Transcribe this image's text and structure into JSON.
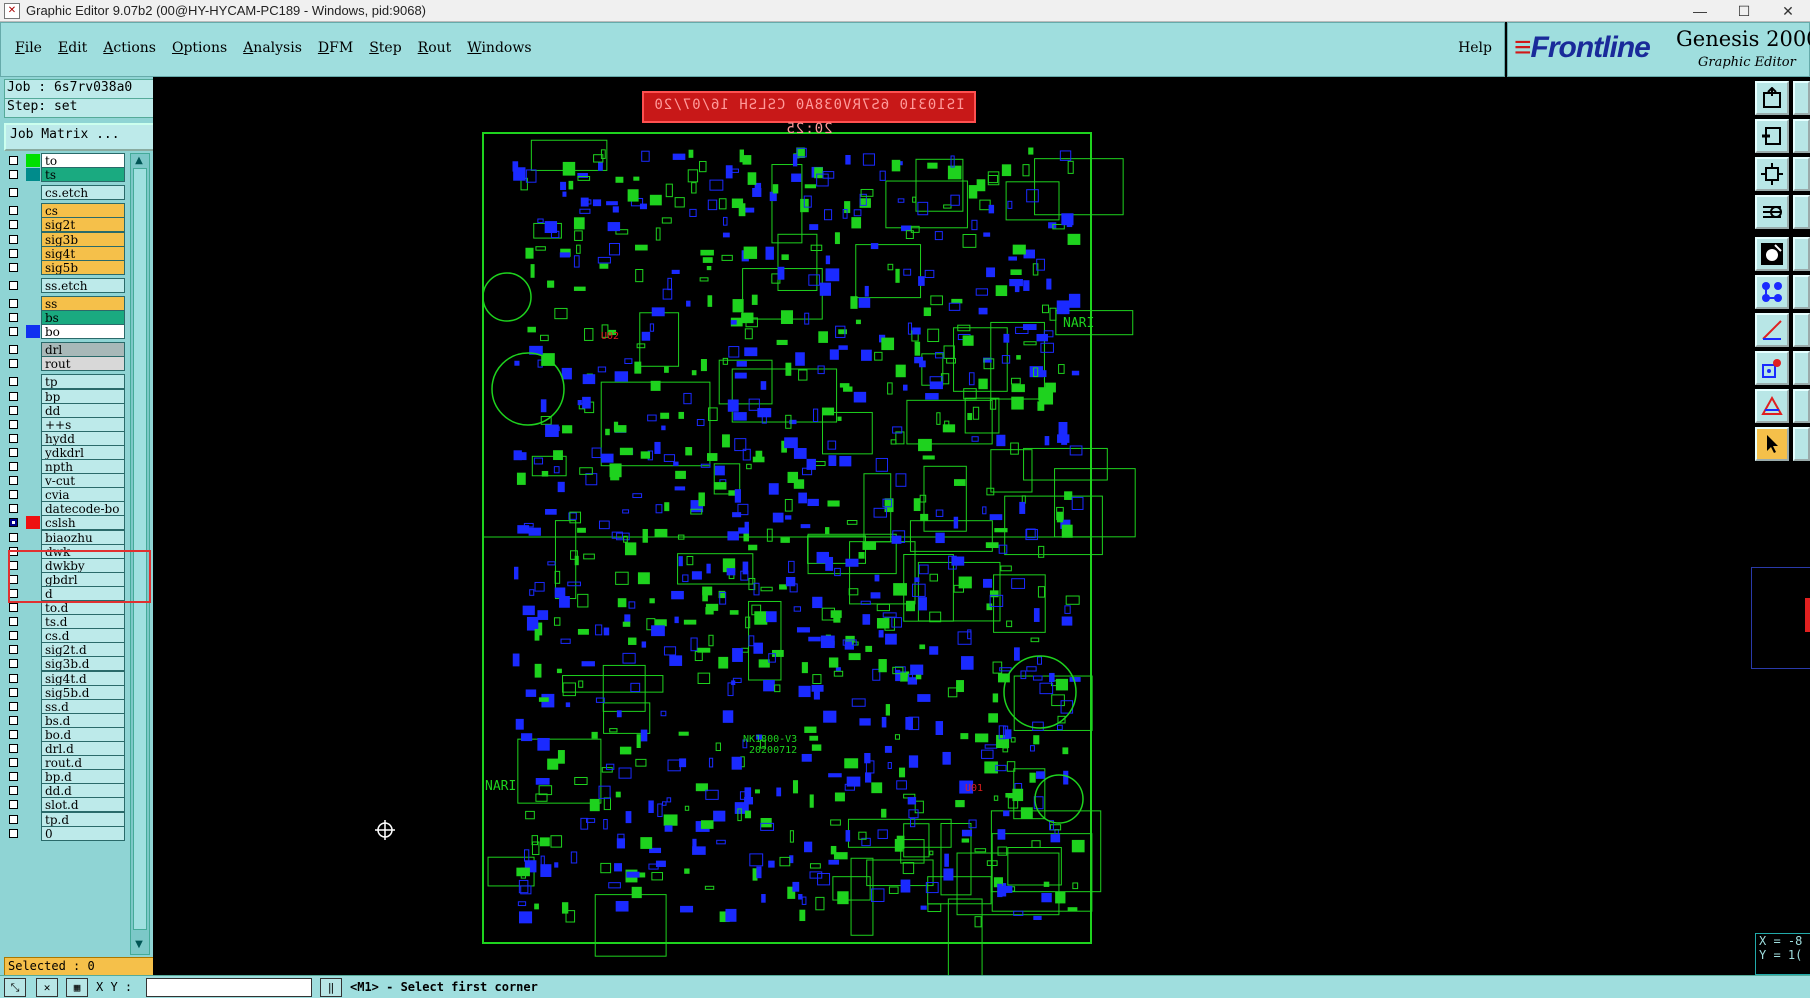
{
  "window": {
    "title": "Graphic Editor 9.07b2 (00@HY-HYCAM-PC189 - Windows, pid:9068)"
  },
  "menu": {
    "items": [
      "File",
      "Edit",
      "Actions",
      "Options",
      "Analysis",
      "DFM",
      "Step",
      "Rout",
      "Windows"
    ],
    "help": "Help"
  },
  "logo": {
    "brand": "Frontline",
    "product": "Genesis 2000",
    "subtitle": "Graphic Editor"
  },
  "job": {
    "job_label": "Job : 6s7rv038a0",
    "step_label": "Step: set",
    "matrix_button": "Job Matrix ..."
  },
  "layers": [
    {
      "name": "to",
      "color": "#00e000",
      "bg": "#ffffff",
      "checked": false,
      "group": 0
    },
    {
      "name": "ts",
      "color": "#008b8b",
      "bg": "#1aaa80",
      "checked": false,
      "group": 0
    },
    {
      "name": "cs.etch",
      "color": "",
      "bg": "#bdeaea",
      "checked": false,
      "group": 1
    },
    {
      "name": "cs",
      "color": "",
      "bg": "#f5c04a",
      "checked": false,
      "group": 2
    },
    {
      "name": "sig2t",
      "color": "",
      "bg": "#f5c04a",
      "checked": false,
      "group": 2
    },
    {
      "name": "sig3b",
      "color": "",
      "bg": "#f5c04a",
      "checked": false,
      "group": 2
    },
    {
      "name": "sig4t",
      "color": "",
      "bg": "#f5c04a",
      "checked": false,
      "group": 2
    },
    {
      "name": "sig5b",
      "color": "",
      "bg": "#f5c04a",
      "checked": false,
      "group": 2
    },
    {
      "name": "ss.etch",
      "color": "",
      "bg": "#bdeaea",
      "checked": false,
      "group": 3
    },
    {
      "name": "ss",
      "color": "",
      "bg": "#f5c04a",
      "checked": false,
      "group": 4
    },
    {
      "name": "bs",
      "color": "",
      "bg": "#1aaa80",
      "checked": false,
      "group": 4
    },
    {
      "name": "bo",
      "color": "#1030f0",
      "bg": "#ffffff",
      "checked": false,
      "group": 4
    },
    {
      "name": "drl",
      "color": "",
      "bg": "#a8b8b8",
      "checked": false,
      "group": 5
    },
    {
      "name": "rout",
      "color": "",
      "bg": "#d8d8d8",
      "checked": false,
      "group": 5
    },
    {
      "name": "tp",
      "color": "",
      "bg": "#bdeaea",
      "checked": false,
      "group": 6
    },
    {
      "name": "bp",
      "color": "",
      "bg": "#bdeaea",
      "checked": false,
      "group": 6
    },
    {
      "name": "dd",
      "color": "",
      "bg": "#bdeaea",
      "checked": false,
      "group": 6
    },
    {
      "name": "++s",
      "color": "",
      "bg": "#bdeaea",
      "checked": false,
      "group": 6
    },
    {
      "name": "hydd",
      "color": "",
      "bg": "#bdeaea",
      "checked": false,
      "group": 6
    },
    {
      "name": "ydkdrl",
      "color": "",
      "bg": "#bdeaea",
      "checked": false,
      "group": 6
    },
    {
      "name": "npth",
      "color": "",
      "bg": "#bdeaea",
      "checked": false,
      "group": 6
    },
    {
      "name": "v-cut",
      "color": "",
      "bg": "#bdeaea",
      "checked": false,
      "group": 6
    },
    {
      "name": "cvia",
      "color": "",
      "bg": "#bdeaea",
      "checked": false,
      "group": 6
    },
    {
      "name": "datecode-bo",
      "color": "",
      "bg": "#bdeaea",
      "checked": false,
      "group": 6
    },
    {
      "name": "cslsh",
      "color": "#ee1010",
      "bg": "#bdeaea",
      "checked": true,
      "group": 6
    },
    {
      "name": "biaozhu",
      "color": "",
      "bg": "#bdeaea",
      "checked": false,
      "group": 6
    },
    {
      "name": "dwk",
      "color": "",
      "bg": "#bdeaea",
      "checked": false,
      "group": 6
    },
    {
      "name": "dwkby",
      "color": "",
      "bg": "#bdeaea",
      "checked": false,
      "group": 6
    },
    {
      "name": "gbdrl",
      "color": "",
      "bg": "#bdeaea",
      "checked": false,
      "group": 6
    },
    {
      "name": "d",
      "color": "",
      "bg": "#bdeaea",
      "checked": false,
      "group": 6
    },
    {
      "name": "to.d",
      "color": "",
      "bg": "#bdeaea",
      "checked": false,
      "group": 6
    },
    {
      "name": "ts.d",
      "color": "",
      "bg": "#bdeaea",
      "checked": false,
      "group": 6
    },
    {
      "name": "cs.d",
      "color": "",
      "bg": "#bdeaea",
      "checked": false,
      "group": 6
    },
    {
      "name": "sig2t.d",
      "color": "",
      "bg": "#bdeaea",
      "checked": false,
      "group": 6
    },
    {
      "name": "sig3b.d",
      "color": "",
      "bg": "#bdeaea",
      "checked": false,
      "group": 6
    },
    {
      "name": "sig4t.d",
      "color": "",
      "bg": "#bdeaea",
      "checked": false,
      "group": 6
    },
    {
      "name": "sig5b.d",
      "color": "",
      "bg": "#bdeaea",
      "checked": false,
      "group": 6
    },
    {
      "name": "ss.d",
      "color": "",
      "bg": "#bdeaea",
      "checked": false,
      "group": 6
    },
    {
      "name": "bs.d",
      "color": "",
      "bg": "#bdeaea",
      "checked": false,
      "group": 6
    },
    {
      "name": "bo.d",
      "color": "",
      "bg": "#bdeaea",
      "checked": false,
      "group": 6
    },
    {
      "name": "drl.d",
      "color": "",
      "bg": "#bdeaea",
      "checked": false,
      "group": 6
    },
    {
      "name": "rout.d",
      "color": "",
      "bg": "#bdeaea",
      "checked": false,
      "group": 6
    },
    {
      "name": "bp.d",
      "color": "",
      "bg": "#bdeaea",
      "checked": false,
      "group": 6
    },
    {
      "name": "dd.d",
      "color": "",
      "bg": "#bdeaea",
      "checked": false,
      "group": 6
    },
    {
      "name": "slot.d",
      "color": "",
      "bg": "#bdeaea",
      "checked": false,
      "group": 6
    },
    {
      "name": "tp.d",
      "color": "",
      "bg": "#bdeaea",
      "checked": false,
      "group": 6
    },
    {
      "name": "0",
      "color": "",
      "bg": "#bdeaea",
      "checked": false,
      "group": 6
    }
  ],
  "selected_label": "Selected : 0",
  "canvas": {
    "red_label": "IS10310 6S7RV038A0 CSLSH 16/07/20 20:25",
    "board_text_top": "NARI",
    "board_text_bottom": "NARI",
    "part_text_1": "NK1800-V3",
    "part_text_2": "20200712",
    "ref_u1": "U01",
    "ref_u2": "U02"
  },
  "coords": {
    "x": "X = -8",
    "y": "Y = 1("
  },
  "status": {
    "xy_label": "X Y :",
    "prompt": "<M1> - Select first corner"
  },
  "colors": {
    "panel": "#9fdede",
    "highlight": "#f5c04a",
    "trace_green": "#1ed21e",
    "trace_blue": "#1a2aff"
  }
}
